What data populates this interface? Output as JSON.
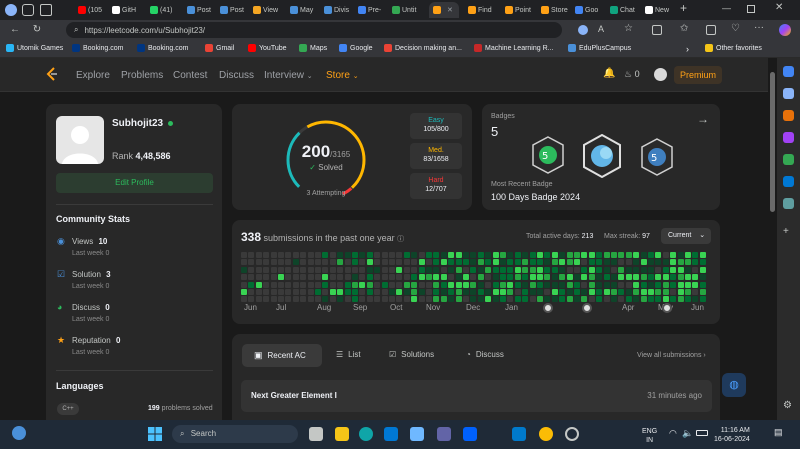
{
  "browser": {
    "tabs": [
      {
        "label": "(105",
        "color": "#ff0000"
      },
      {
        "label": "GitH",
        "color": "#ffffff"
      },
      {
        "label": "(41) ",
        "color": "#25d366"
      },
      {
        "label": "Post",
        "color": "#4a90d9"
      },
      {
        "label": "Post",
        "color": "#4a90d9"
      },
      {
        "label": "View",
        "color": "#f5a623"
      },
      {
        "label": "May",
        "color": "#4a90d9"
      },
      {
        "label": "Divis",
        "color": "#4a90d9"
      },
      {
        "label": "Pre-",
        "color": "#4285f4"
      },
      {
        "label": "Untit",
        "color": "#34a853"
      },
      {
        "label": "",
        "color": "#ffa116"
      },
      {
        "label": "Find",
        "color": "#ffa116"
      },
      {
        "label": "Point",
        "color": "#ffa116"
      },
      {
        "label": "Store",
        "color": "#ffa116"
      },
      {
        "label": "Goo",
        "color": "#4285f4"
      },
      {
        "label": "Chat",
        "color": "#10a37f"
      },
      {
        "label": "New",
        "color": "#ffffff"
      }
    ],
    "url": "https://leetcode.com/u/Subhojit23/",
    "bookmarks": [
      {
        "label": "Utomik Games",
        "color": "#29b6f6"
      },
      {
        "label": "Booking.com",
        "color": "#003580"
      },
      {
        "label": "Booking.com",
        "color": "#003580"
      },
      {
        "label": "Gmail",
        "color": "#ea4335"
      },
      {
        "label": "YouTube",
        "color": "#ff0000"
      },
      {
        "label": "Maps",
        "color": "#34a853"
      },
      {
        "label": "Google",
        "color": "#4285f4"
      },
      {
        "label": "Decision making an...",
        "color": "#ea4335"
      },
      {
        "label": "Machine Learning R...",
        "color": "#c62828"
      },
      {
        "label": "EduPlusCampus",
        "color": "#4a90d9"
      }
    ],
    "other_favorites": "Other favorites"
  },
  "nav": {
    "links": [
      "Explore",
      "Problems",
      "Contest",
      "Discuss",
      "Interview"
    ],
    "store": "Store",
    "coins": "0",
    "premium": "Premium"
  },
  "profile": {
    "username": "Subhojit23",
    "rank_label": "Rank",
    "rank": "4,48,586",
    "edit": "Edit Profile"
  },
  "community": {
    "title": "Community Stats",
    "items": [
      {
        "label": "Views",
        "value": "10",
        "sub": "Last week 0",
        "color": "#4a90d9"
      },
      {
        "label": "Solution",
        "value": "3",
        "sub": "Last week 0",
        "color": "#4a90d9"
      },
      {
        "label": "Discuss",
        "value": "0",
        "sub": "Last week 0",
        "color": "#2cbb5d"
      },
      {
        "label": "Reputation",
        "value": "0",
        "sub": "Last week 0",
        "color": "#ffa116"
      }
    ]
  },
  "languages": {
    "title": "Languages",
    "items": [
      {
        "name": "C++",
        "count": "199",
        "suffix": "problems solved"
      }
    ]
  },
  "solved": {
    "count": "200",
    "total": "/3165",
    "label": "Solved",
    "attempting": "3 Attempting",
    "fraction": 0.063,
    "easy": {
      "label": "Easy",
      "value": "105/800",
      "color": "#1cbaba"
    },
    "medium": {
      "label": "Med.",
      "value": "83/1658",
      "color": "#ffb700"
    },
    "hard": {
      "label": "Hard",
      "value": "12/707",
      "color": "#f63737"
    }
  },
  "badges": {
    "title": "Badges",
    "count": "5",
    "recent_label": "Most Recent Badge",
    "recent": "100 Days Badge 2024"
  },
  "submissions": {
    "count": "338",
    "text": "submissions in the past one year",
    "active_label": "Total active days:",
    "active": "213",
    "streak_label": "Max streak:",
    "streak": "97",
    "current": "Current",
    "months": [
      "Jun",
      "Jul",
      "Aug",
      "Sep",
      "Oct",
      "Nov",
      "Dec",
      "Jan",
      "Feb",
      "Mar",
      "Apr",
      "May",
      "Jun"
    ]
  },
  "tabs": {
    "items": [
      "Recent AC",
      "List",
      "Solutions",
      "Discuss"
    ],
    "view_all": "View all submissions"
  },
  "recent": [
    {
      "title": "Next Greater Element I",
      "time": "31 minutes ago"
    }
  ],
  "taskbar": {
    "search": "Search",
    "lang1": "ENG",
    "lang2": "IN",
    "time": "11:16 AM",
    "date": "16-06-2024"
  },
  "colors": {
    "accent": "#ffa116",
    "green": "#2cbb5d",
    "card": "#282828",
    "bg": "#1a1a1a"
  }
}
